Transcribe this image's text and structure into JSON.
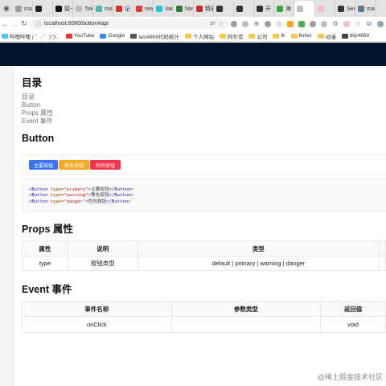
{
  "browser": {
    "tabs": [
      {
        "label": "mar",
        "color": "#9e9e9e",
        "active": false
      },
      {
        "label": "",
        "color": "#222222",
        "active": false
      },
      {
        "label": "猿一",
        "color": "#111111",
        "active": false
      },
      {
        "label": "Tok",
        "color": "#bdbdbd",
        "active": false
      },
      {
        "label": "mar",
        "color": "#4db6ac",
        "active": false
      },
      {
        "label": "记",
        "color": "#d32f2f",
        "active": false
      },
      {
        "label": "rea",
        "color": "#e53935",
        "active": false
      },
      {
        "label": "Varc",
        "color": "#26c6da",
        "active": false
      },
      {
        "label": "Nav",
        "color": "#2e7d32",
        "active": false
      },
      {
        "label": "精彩",
        "color": "#c62828",
        "active": false
      },
      {
        "label": "",
        "color": "#333333",
        "active": false
      },
      {
        "label": "",
        "color": "#333333",
        "active": false
      },
      {
        "label": "开",
        "color": "#333333",
        "active": false
      },
      {
        "label": "海",
        "color": "#43a047",
        "active": false
      },
      {
        "label": "",
        "color": "#bdbdbd",
        "active": true
      },
      {
        "label": "",
        "color": "#f8bbd0",
        "active": false
      },
      {
        "label": "See",
        "color": "#333333",
        "active": false
      },
      {
        "label": "mar",
        "color": "#607d8b",
        "active": false
      }
    ],
    "url": "localhost:8080/button#api",
    "zoom_label": "aᵃ",
    "bookmarks": [
      {
        "label": "哔哩哔哩 ( ゜- ゜)つ...",
        "color": "#4fc3f7"
      },
      {
        "label": "YouTube",
        "color": "#e53935"
      },
      {
        "label": "Google",
        "color": "#4285f4"
      },
      {
        "label": "last4869代码统计",
        "color": "#555555"
      },
      {
        "label": "个人网站",
        "color": "#f9c74f"
      },
      {
        "label": "阿尔克",
        "color": "#f9c74f"
      },
      {
        "label": "公司",
        "color": "#f9c74f"
      },
      {
        "label": "fk",
        "color": "#f9c74f"
      },
      {
        "label": "flutter",
        "color": "#f9c74f"
      },
      {
        "label": "动漫",
        "color": "#f9c74f"
      },
      {
        "label": "dliy4869",
        "color": "#444444"
      }
    ]
  },
  "page": {
    "toc_title": "目录",
    "toc": [
      "目录",
      "Button",
      "Props 属性",
      "Event 事件"
    ],
    "button_title": "Button",
    "buttons": [
      {
        "label": "主要按钮",
        "color": "#3873f5"
      },
      {
        "label": "警告按钮",
        "color": "#f5a623"
      },
      {
        "label": "危险按钮",
        "color": "#f5334b"
      }
    ],
    "code": [
      {
        "open": "<Button",
        "attr": "type=",
        "val": "\"primary\"",
        "close": ">",
        "text": "主要按钮",
        "end": "</Button>"
      },
      {
        "open": "<Button",
        "attr": "type=",
        "val": "\"warning\"",
        "close": ">",
        "text": "警告按钮",
        "end": "</Button>"
      },
      {
        "open": "<Button",
        "attr": "type=",
        "val": "\"danger\"",
        "close": ">",
        "text": "危险按钮",
        "end": "</Button>"
      }
    ],
    "props_title": "Props 属性",
    "props_headers": [
      "属性",
      "说明",
      "类型",
      ""
    ],
    "props_rows": [
      [
        "type",
        "按钮类型",
        "default | primary | warning | danger",
        ""
      ]
    ],
    "event_title": "Event 事件",
    "event_headers": [
      "事件名称",
      "参数类型",
      "返回值"
    ],
    "event_rows": [
      [
        "onClick",
        "",
        "void"
      ]
    ]
  },
  "watermark": "@稀土掘金技术社区"
}
